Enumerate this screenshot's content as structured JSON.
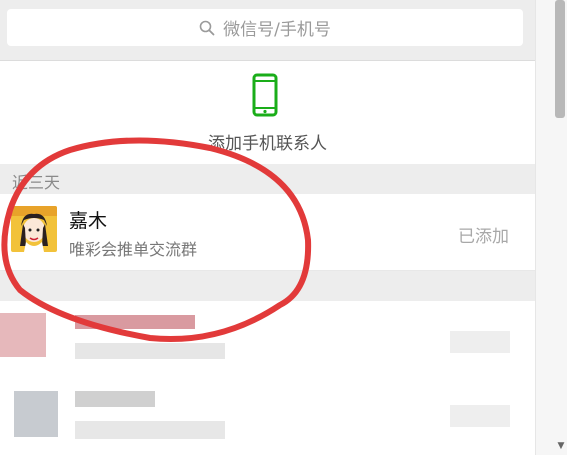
{
  "search": {
    "placeholder": "微信号/手机号",
    "icon": "search-icon"
  },
  "add_phone": {
    "label": "添加手机联系人",
    "icon": "phone-icon",
    "icon_color": "#1aad19"
  },
  "sections": [
    {
      "title": "近三天"
    },
    {
      "title": ""
    }
  ],
  "contacts": [
    {
      "name": "嘉木",
      "subtitle": "唯彩会推单交流群",
      "status": "已添加"
    }
  ],
  "colors": {
    "annotation": "#e23a3a",
    "background": "#ededed",
    "accent": "#1aad19"
  }
}
